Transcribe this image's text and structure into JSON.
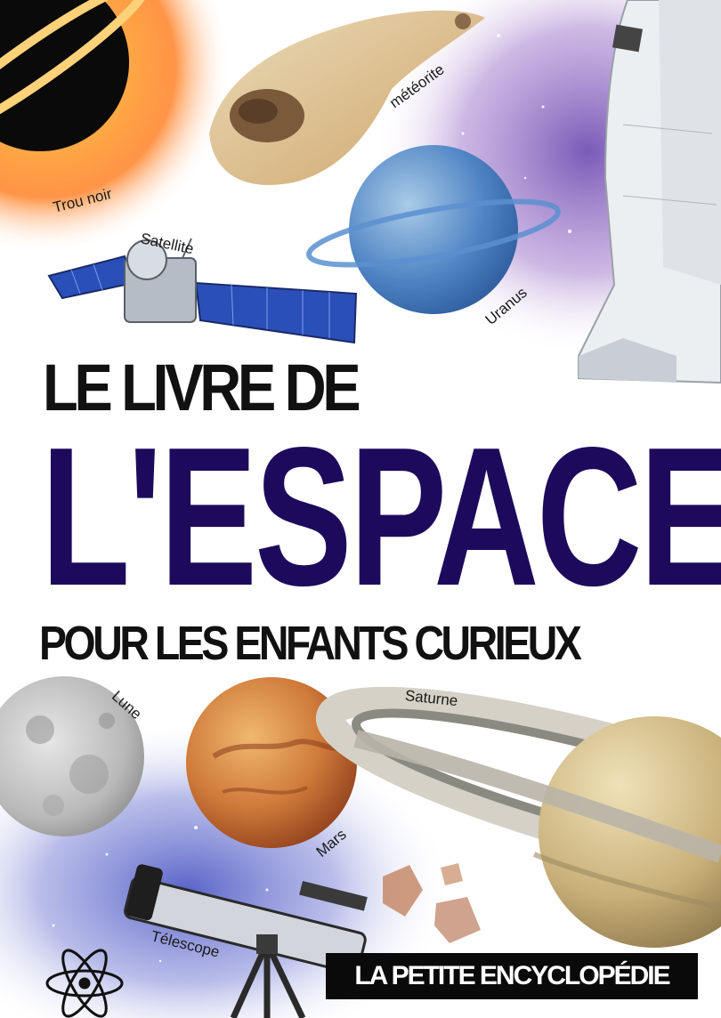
{
  "cover": {
    "title_line1": "LE LIVRE DE",
    "title_line2": "L'ESPACE",
    "title_line3": "POUR LES ENFANTS CURIEUX",
    "series_badge": "LA PETITE ENCYCLOPÉDIE"
  },
  "labels": {
    "black_hole": "Trou noir",
    "meteorite": "météorite",
    "satellite": "Satellite",
    "uranus": "Uranus",
    "moon": "Lune",
    "saturn": "Saturne",
    "mars": "Mars",
    "telescope": "Télescope"
  },
  "colors": {
    "title_accent": "#1e0a5c",
    "title_dark": "#111111",
    "badge_bg": "#0a0a0a",
    "badge_text": "#ffffff"
  },
  "icons": [
    "black-hole-icon",
    "meteorite-icon",
    "satellite-icon",
    "uranus-icon",
    "space-shuttle-icon",
    "moon-icon",
    "mars-icon",
    "saturn-icon",
    "telescope-icon",
    "rocks-icon",
    "atom-icon"
  ]
}
